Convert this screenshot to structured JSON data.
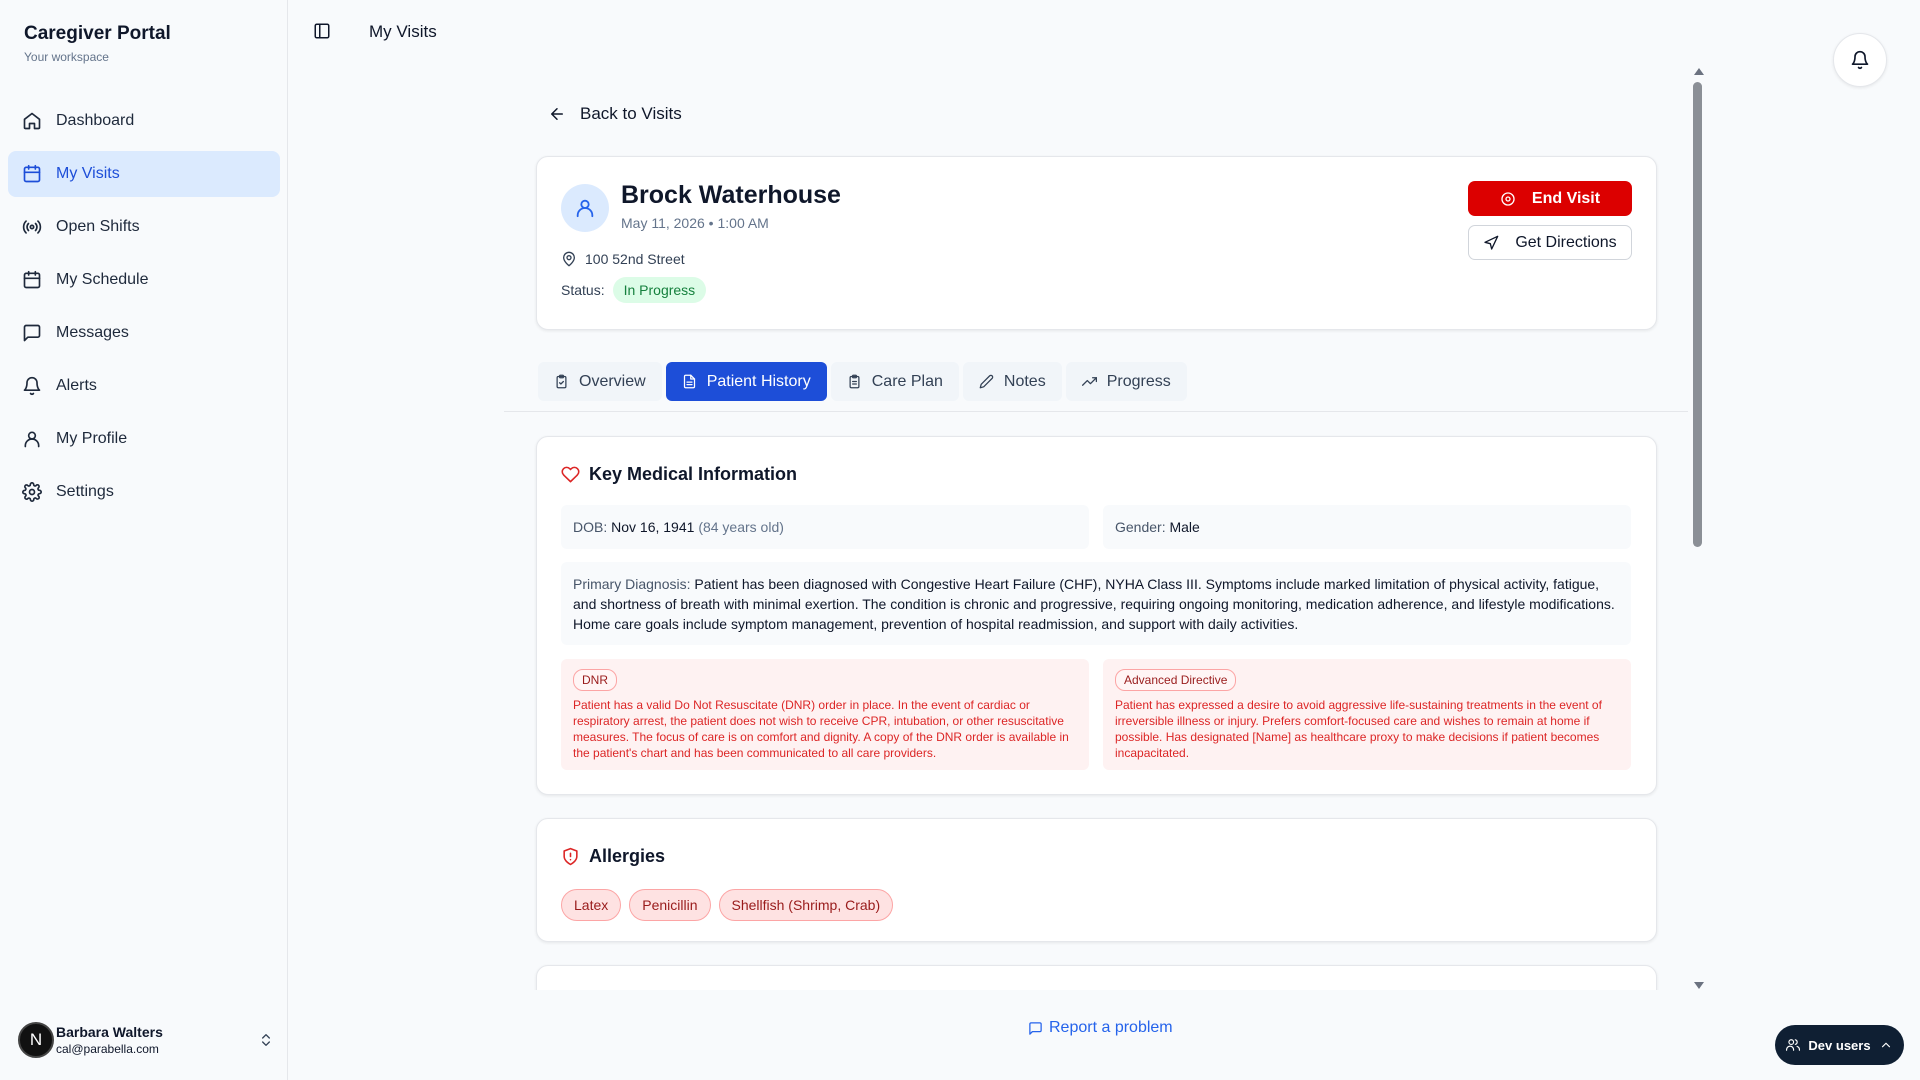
{
  "sidebar": {
    "brand_title": "Caregiver Portal",
    "brand_subtitle": "Your workspace",
    "items": [
      {
        "label": "Dashboard",
        "icon": "home-icon"
      },
      {
        "label": "My Visits",
        "icon": "calendar-icon",
        "active": true
      },
      {
        "label": "Open Shifts",
        "icon": "broadcast-icon"
      },
      {
        "label": "My Schedule",
        "icon": "calendar-icon"
      },
      {
        "label": "Messages",
        "icon": "message-icon"
      },
      {
        "label": "Alerts",
        "icon": "bell-icon"
      },
      {
        "label": "My Profile",
        "icon": "user-icon"
      },
      {
        "label": "Settings",
        "icon": "gear-icon"
      }
    ],
    "user": {
      "initial": "N",
      "name": "Barbara Walters",
      "email": "cal@parabella.com"
    }
  },
  "header": {
    "page_title": "My Visits"
  },
  "visit": {
    "back_label": "Back to Visits",
    "patient_name": "Brock Waterhouse",
    "datetime": "May 11, 2026 • 1:00 AM",
    "address": "100 52nd Street",
    "status_label": "Status:",
    "status": "In Progress",
    "end_visit_label": "End Visit",
    "directions_label": "Get Directions"
  },
  "tabs": [
    {
      "label": "Overview",
      "icon": "clipboard-icon"
    },
    {
      "label": "Patient History",
      "icon": "document-icon",
      "active": true
    },
    {
      "label": "Care Plan",
      "icon": "clipboard-list-icon"
    },
    {
      "label": "Notes",
      "icon": "pencil-icon"
    },
    {
      "label": "Progress",
      "icon": "trending-up-icon"
    }
  ],
  "medical": {
    "title": "Key Medical Information",
    "dob_label": "DOB:",
    "dob_value": "Nov 16, 1941",
    "dob_age": "(84 years old)",
    "gender_label": "Gender:",
    "gender_value": "Male",
    "diagnosis_label": "Primary Diagnosis:",
    "diagnosis_text": "Patient has been diagnosed with Congestive Heart Failure (CHF), NYHA Class III. Symptoms include marked limitation of physical activity, fatigue, and shortness of breath with minimal exertion. The condition is chronic and progressive, requiring ongoing monitoring, medication adherence, and lifestyle modifications. Home care goals include symptom management, prevention of hospital readmission, and support with daily activities.",
    "dnr_tag": "DNR",
    "dnr_text": "Patient has a valid Do Not Resuscitate (DNR) order in place. In the event of cardiac or respiratory arrest, the patient does not wish to receive CPR, intubation, or other resuscitative measures. The focus of care is on comfort and dignity. A copy of the DNR order is available in the patient's chart and has been communicated to all care providers.",
    "advance_tag": "Advanced Directive",
    "advance_text": "Patient has expressed a desire to avoid aggressive life-sustaining treatments in the event of irreversible illness or injury. Prefers comfort-focused care and wishes to remain at home if possible. Has designated [Name] as healthcare proxy to make decisions if patient becomes incapacitated."
  },
  "allergies": {
    "title": "Allergies",
    "items": [
      "Latex",
      "Penicillin",
      "Shellfish (Shrimp, Crab)"
    ]
  },
  "footer": {
    "report_label": "Report a problem",
    "dev_label": "Dev users"
  },
  "colors": {
    "accent": "#1d4ed8",
    "danger": "#dc0000",
    "success_bg": "#dcfce7",
    "success_text": "#15803d"
  }
}
